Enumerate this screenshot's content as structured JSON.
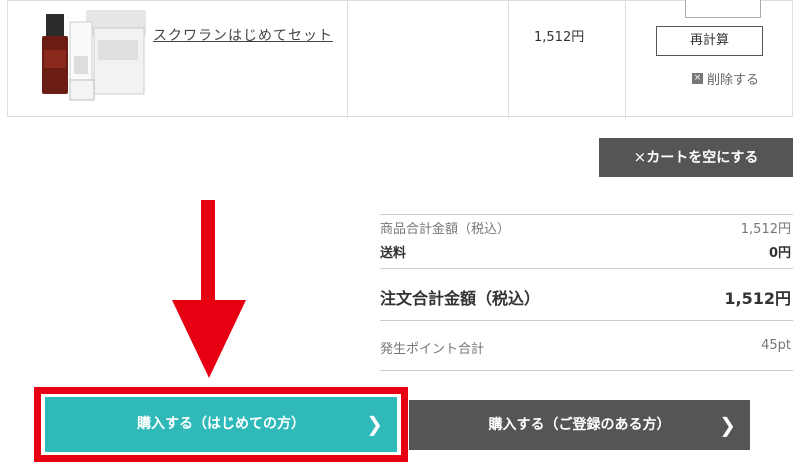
{
  "cart": {
    "product_name": "スクワランはじめてセット",
    "price": "1,512円",
    "recalc_label": "再計算",
    "delete_label": "削除する",
    "empty_cart_label": "カートを空にする"
  },
  "summary": {
    "subtotal_label": "商品合計金額（税込）",
    "subtotal_value": "1,512円",
    "shipping_label": "送料",
    "shipping_value": "0円",
    "total_label": "注文合計金額（税込）",
    "total_value": "1,512円",
    "points_label": "発生ポイント合計",
    "points_value": "45pt"
  },
  "actions": {
    "purchase_first_label": "購入する（はじめての方）",
    "purchase_registered_label": "購入する（ご登録のある方）"
  },
  "colors": {
    "teal": "#2fb9b9",
    "dark": "#555555",
    "highlight_red": "#e60012"
  },
  "icons": {
    "delete": "close-square-icon",
    "empty_cart": "x-icon",
    "chevron": "chevron-right-icon",
    "annotation": "red-down-arrow"
  }
}
